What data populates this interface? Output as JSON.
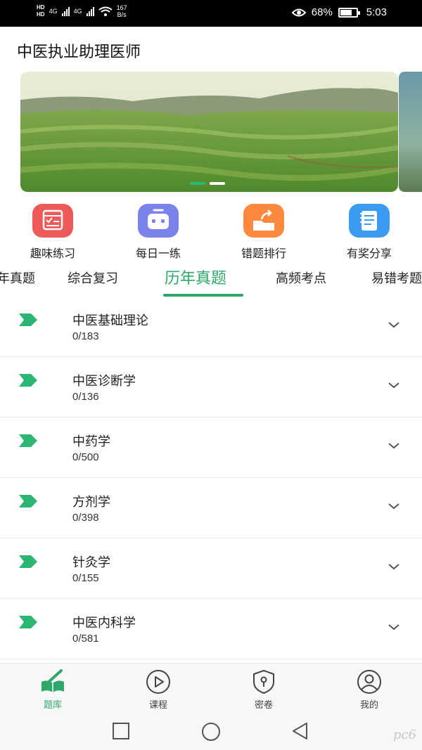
{
  "status_bar": {
    "hd1": "HD",
    "hd2": "HD",
    "net1": "4G",
    "net2": "4G",
    "speed_value": "167",
    "speed_unit": "B/s",
    "battery": "68%",
    "battery_level": 0.68,
    "time": "5:03"
  },
  "app": {
    "title": "中医执业助理医师"
  },
  "banner": {
    "slide_count": 2,
    "active_slide": 0
  },
  "quick_actions": [
    {
      "label": "趣味练习",
      "icon": "practice-icon",
      "color": "#ee5a5a"
    },
    {
      "label": "每日一练",
      "icon": "robot-icon",
      "color": "#7b82ea"
    },
    {
      "label": "错题排行",
      "icon": "share-folder-icon",
      "color": "#ff8a3d"
    },
    {
      "label": "有奖分享",
      "icon": "notebook-icon",
      "color": "#3a9cf0"
    }
  ],
  "tabs": [
    {
      "label": "年真题"
    },
    {
      "label": "综合复习"
    },
    {
      "label": "历年真题",
      "active": true
    },
    {
      "label": "高频考点"
    },
    {
      "label": "易错考题"
    }
  ],
  "subjects": [
    {
      "title": "中医基础理论",
      "count": "0/183"
    },
    {
      "title": "中医诊断学",
      "count": "0/136"
    },
    {
      "title": "中药学",
      "count": "0/500"
    },
    {
      "title": "方剂学",
      "count": "0/398"
    },
    {
      "title": "针灸学",
      "count": "0/155"
    },
    {
      "title": "中医内科学",
      "count": "0/581"
    }
  ],
  "bottom_nav": [
    {
      "label": "题库",
      "icon": "book-icon",
      "active": true
    },
    {
      "label": "课程",
      "icon": "play-icon"
    },
    {
      "label": "密卷",
      "icon": "shield-lock-icon"
    },
    {
      "label": "我的",
      "icon": "user-icon"
    }
  ],
  "colors": {
    "accent": "#2ea86a",
    "arrow": "#2bb673"
  },
  "watermark": "pc6"
}
